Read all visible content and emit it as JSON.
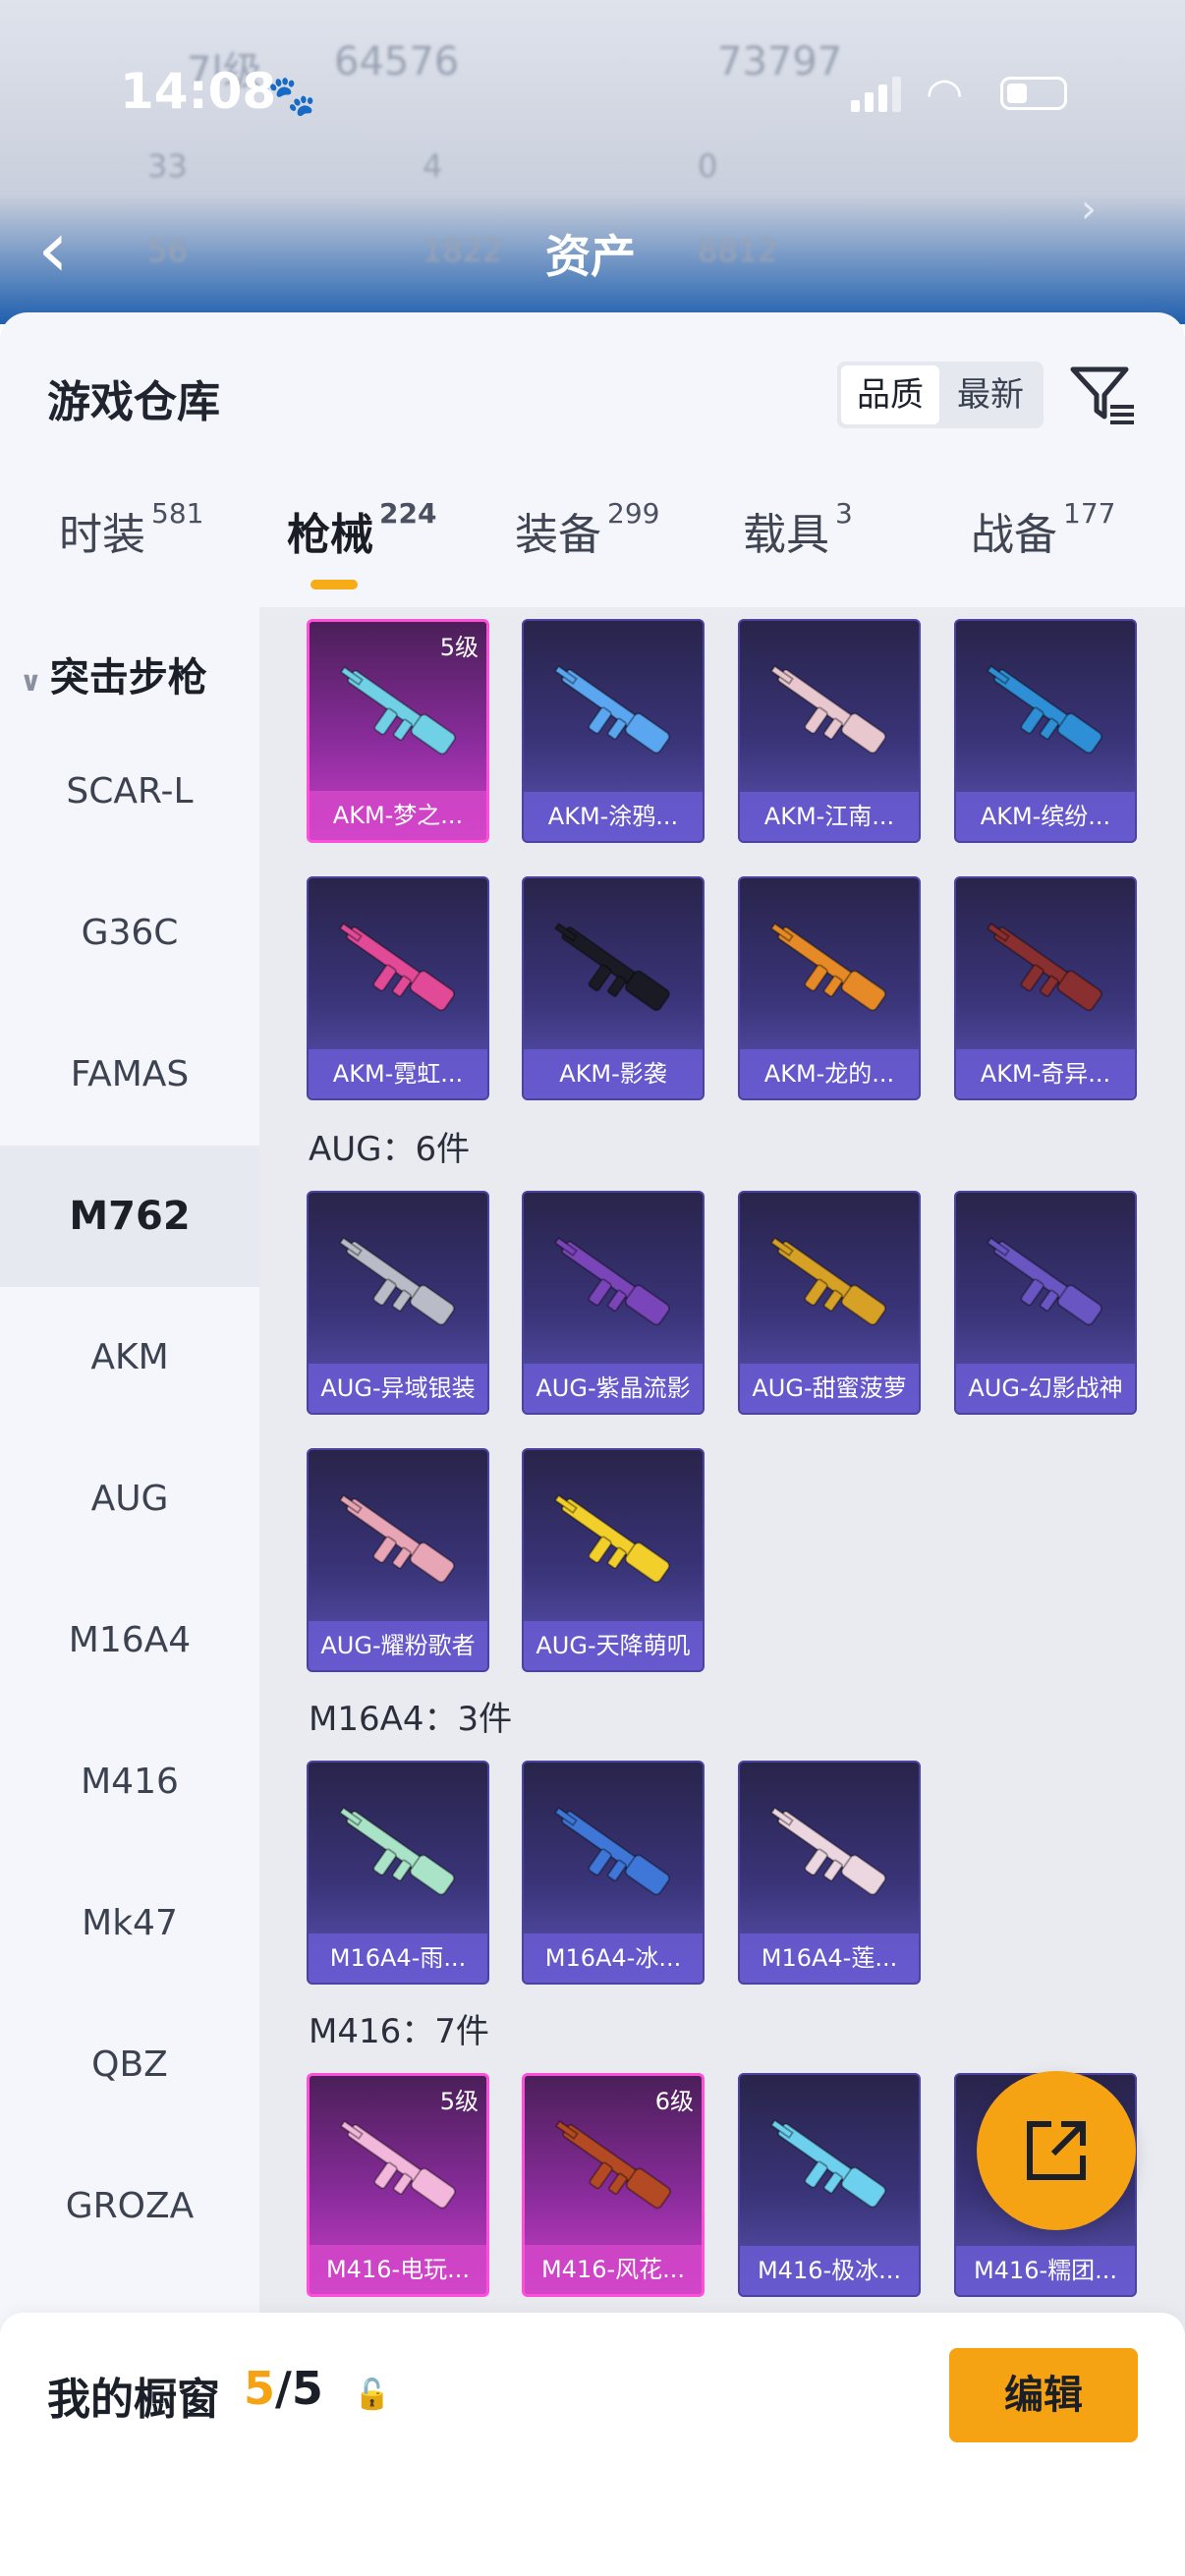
{
  "status_bar": {
    "time": "14:08"
  },
  "background": {
    "title": "资产",
    "blur_texts": [
      "7l级",
      "64576",
      "73797",
      "33",
      "4",
      "0",
      "56",
      "1822",
      "8812"
    ]
  },
  "sheet": {
    "title": "游戏仓库",
    "sort": {
      "options": [
        "品质",
        "最新"
      ],
      "selected": "品质"
    }
  },
  "tabs": [
    {
      "label": "时装",
      "count": "581"
    },
    {
      "label": "枪械",
      "count": "224",
      "active": true
    },
    {
      "label": "装备",
      "count": "299"
    },
    {
      "label": "载具",
      "count": "3"
    },
    {
      "label": "战备",
      "count": "177"
    }
  ],
  "sidebar": {
    "header": "突击步枪",
    "items": [
      "SCAR-L",
      "G36C",
      "FAMAS",
      "M762",
      "AKM",
      "AUG",
      "M16A4",
      "M416",
      "Mk47",
      "QBZ",
      "GROZA"
    ],
    "active": "M762"
  },
  "groups": [
    {
      "header": "",
      "items": [
        {
          "name": "AKM-梦之...",
          "level": "5级",
          "tier": "legend",
          "color": "#6fd0e6"
        },
        {
          "name": "AKM-涂鸦...",
          "tier": "epic",
          "color": "#5aa6f0"
        },
        {
          "name": "AKM-江南...",
          "tier": "epic",
          "color": "#e8c7cf"
        },
        {
          "name": "AKM-缤纷...",
          "tier": "epic",
          "color": "#2f8fd6"
        },
        {
          "name": "AKM-霓虹...",
          "tier": "epic",
          "color": "#e24a97"
        },
        {
          "name": "AKM-影袭",
          "tier": "epic",
          "color": "#1a1a24"
        },
        {
          "name": "AKM-龙的...",
          "tier": "epic",
          "color": "#e58a26"
        },
        {
          "name": "AKM-奇异...",
          "tier": "epic",
          "color": "#8a2f2f"
        }
      ]
    },
    {
      "header": "AUG：6件",
      "items": [
        {
          "name": "AUG-异域银装",
          "tier": "epic",
          "color": "#b9bcc6"
        },
        {
          "name": "AUG-紫晶流影",
          "tier": "epic",
          "color": "#7a45b8"
        },
        {
          "name": "AUG-甜蜜菠萝",
          "tier": "epic",
          "color": "#d6a125"
        },
        {
          "name": "AUG-幻影战神",
          "tier": "epic",
          "color": "#6a56c2"
        },
        {
          "name": "AUG-耀粉歌者",
          "tier": "epic",
          "color": "#e8a5b5"
        },
        {
          "name": "AUG-天降萌叽",
          "tier": "epic",
          "color": "#f2cf2a"
        }
      ]
    },
    {
      "header": "M16A4：3件",
      "items": [
        {
          "name": "M16A4-雨...",
          "tier": "epic",
          "color": "#a9e3c8"
        },
        {
          "name": "M16A4-冰...",
          "tier": "epic",
          "color": "#3f77d8"
        },
        {
          "name": "M16A4-莲...",
          "tier": "epic",
          "color": "#ecd6df"
        }
      ]
    },
    {
      "header": "M416：7件",
      "items": [
        {
          "name": "M416-电玩...",
          "level": "5级",
          "tier": "legend",
          "color": "#f2b7da"
        },
        {
          "name": "M416-风花...",
          "level": "6级",
          "tier": "legend",
          "color": "#b34a24"
        },
        {
          "name": "M416-极冰...",
          "tier": "epic",
          "color": "#6ed0ef"
        },
        {
          "name": "M416-糯团...",
          "tier": "epic",
          "color": "#c9a6f0"
        }
      ]
    }
  ],
  "bottom": {
    "label": "我的橱窗",
    "used": "5",
    "sep_total": "/5",
    "edit_label": "编辑"
  }
}
